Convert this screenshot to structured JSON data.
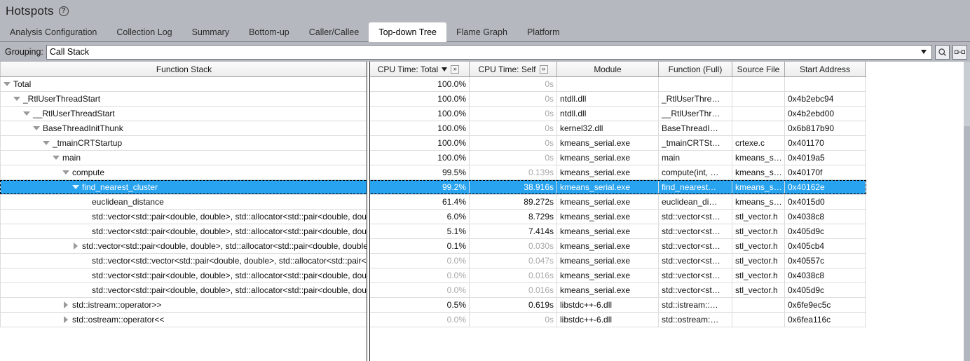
{
  "window": {
    "title": "Hotspots",
    "help_icon": "question-circle-icon"
  },
  "tabs": [
    {
      "label": "Analysis Configuration",
      "active": false
    },
    {
      "label": "Collection Log",
      "active": false
    },
    {
      "label": "Summary",
      "active": false
    },
    {
      "label": "Bottom-up",
      "active": false
    },
    {
      "label": "Caller/Callee",
      "active": false
    },
    {
      "label": "Top-down Tree",
      "active": true
    },
    {
      "label": "Flame Graph",
      "active": false
    },
    {
      "label": "Platform",
      "active": false
    }
  ],
  "toolbar": {
    "grouping_label": "Grouping:",
    "grouping_value": "Call Stack",
    "search_icon": "magnifier-icon",
    "swap_icon": "data-transfer-icon",
    "dropdown_icon": "chevron-down-icon"
  },
  "table": {
    "columns": [
      {
        "label": "Function Stack",
        "sorted": false,
        "more": false
      },
      {
        "label": "CPU Time: Total",
        "sorted": true,
        "sort_dir": "desc",
        "more": true
      },
      {
        "label": "CPU Time: Self",
        "sorted": false,
        "more": true
      },
      {
        "label": "Module",
        "sorted": false,
        "more": false
      },
      {
        "label": "Function (Full)",
        "sorted": false,
        "more": false
      },
      {
        "label": "Source File",
        "sorted": false,
        "more": false
      },
      {
        "label": "Start Address",
        "sorted": false,
        "more": false
      }
    ],
    "rows": [
      {
        "depth": 0,
        "twisty": "down",
        "name": "Total",
        "total": "100.0%",
        "self": "0s",
        "module": "",
        "function": "",
        "source": "",
        "address": "",
        "selected": false,
        "total_dim": false,
        "self_dim": true
      },
      {
        "depth": 1,
        "twisty": "down",
        "name": "_RtlUserThreadStart",
        "total": "100.0%",
        "self": "0s",
        "module": "ntdll.dll",
        "function": "_RtlUserThre…",
        "source": "",
        "address": "0x4b2ebc94",
        "selected": false,
        "total_dim": false,
        "self_dim": true
      },
      {
        "depth": 2,
        "twisty": "down",
        "name": "__RtlUserThreadStart",
        "total": "100.0%",
        "self": "0s",
        "module": "ntdll.dll",
        "function": "__RtlUserThr…",
        "source": "",
        "address": "0x4b2ebd00",
        "selected": false,
        "total_dim": false,
        "self_dim": true
      },
      {
        "depth": 3,
        "twisty": "down",
        "name": "BaseThreadInitThunk",
        "total": "100.0%",
        "self": "0s",
        "module": "kernel32.dll",
        "function": "BaseThreadI…",
        "source": "",
        "address": "0x6b817b90",
        "selected": false,
        "total_dim": false,
        "self_dim": true
      },
      {
        "depth": 4,
        "twisty": "down",
        "name": "_tmainCRTStartup",
        "total": "100.0%",
        "self": "0s",
        "module": "kmeans_serial.exe",
        "function": "_tmainCRTSt…",
        "source": "crtexe.c",
        "address": "0x401170",
        "selected": false,
        "total_dim": false,
        "self_dim": true
      },
      {
        "depth": 5,
        "twisty": "down",
        "name": "main",
        "total": "100.0%",
        "self": "0s",
        "module": "kmeans_serial.exe",
        "function": "main",
        "source": "kmeans_s…",
        "address": "0x4019a5",
        "selected": false,
        "total_dim": false,
        "self_dim": true
      },
      {
        "depth": 6,
        "twisty": "down",
        "name": "compute",
        "total": "99.5%",
        "self": "0.139s",
        "module": "kmeans_serial.exe",
        "function": "compute(int, …",
        "source": "kmeans_s…",
        "address": "0x40170f",
        "selected": false,
        "total_dim": false,
        "self_dim": true
      },
      {
        "depth": 7,
        "twisty": "down",
        "name": "find_nearest_cluster",
        "total": "99.2%",
        "self": "38.916s",
        "module": "kmeans_serial.exe",
        "function": "find_nearest…",
        "source": "kmeans_s…",
        "address": "0x40162e",
        "selected": true,
        "total_dim": false,
        "self_dim": false
      },
      {
        "depth": 8,
        "twisty": "none",
        "name": "euclidean_distance",
        "total": "61.4%",
        "self": "89.272s",
        "module": "kmeans_serial.exe",
        "function": "euclidean_di…",
        "source": "kmeans_s…",
        "address": "0x4015d0",
        "selected": false,
        "total_dim": false,
        "self_dim": false
      },
      {
        "depth": 8,
        "twisty": "none",
        "name": "std::vector<std::pair<double, double>, std::allocator<std::pair<double, double>>>::operator[]",
        "total": "6.0%",
        "self": "8.729s",
        "module": "kmeans_serial.exe",
        "function": "std::vector<st…",
        "source": "stl_vector.h",
        "address": "0x4038c8",
        "selected": false,
        "total_dim": false,
        "self_dim": false
      },
      {
        "depth": 8,
        "twisty": "none",
        "name": "std::vector<std::pair<double, double>, std::allocator<std::pair<double, double>>>::size",
        "total": "5.1%",
        "self": "7.414s",
        "module": "kmeans_serial.exe",
        "function": "std::vector<st…",
        "source": "stl_vector.h",
        "address": "0x405d9c",
        "selected": false,
        "total_dim": false,
        "self_dim": false
      },
      {
        "depth": 7,
        "twisty": "right",
        "name": "std::vector<std::pair<double, double>, std::allocator<std::pair<double, double>>>::begin",
        "total": "0.1%",
        "self": "0.030s",
        "module": "kmeans_serial.exe",
        "function": "std::vector<st…",
        "source": "stl_vector.h",
        "address": "0x405cb4",
        "selected": false,
        "total_dim": false,
        "self_dim": true
      },
      {
        "depth": 8,
        "twisty": "none",
        "name": "std::vector<std::vector<std::pair<double, double>, std::allocator<std::pair<double, double>>>>::operator[]",
        "total": "0.0%",
        "self": "0.047s",
        "module": "kmeans_serial.exe",
        "function": "std::vector<st…",
        "source": "stl_vector.h",
        "address": "0x40557c",
        "selected": false,
        "total_dim": true,
        "self_dim": true
      },
      {
        "depth": 8,
        "twisty": "none",
        "name": "std::vector<std::pair<double, double>, std::allocator<std::pair<double, double>>>::operator[]",
        "total": "0.0%",
        "self": "0.016s",
        "module": "kmeans_serial.exe",
        "function": "std::vector<st…",
        "source": "stl_vector.h",
        "address": "0x4038c8",
        "selected": false,
        "total_dim": true,
        "self_dim": true
      },
      {
        "depth": 8,
        "twisty": "none",
        "name": "std::vector<std::pair<double, double>, std::allocator<std::pair<double, double>>>::size",
        "total": "0.0%",
        "self": "0.016s",
        "module": "kmeans_serial.exe",
        "function": "std::vector<st…",
        "source": "stl_vector.h",
        "address": "0x405d9c",
        "selected": false,
        "total_dim": true,
        "self_dim": true
      },
      {
        "depth": 6,
        "twisty": "right",
        "name": "std::istream::operator>>",
        "total": "0.5%",
        "self": "0.619s",
        "module": "libstdc++-6.dll",
        "function": "std::istream::…",
        "source": "",
        "address": "0x6fe9ec5c",
        "selected": false,
        "total_dim": false,
        "self_dim": false
      },
      {
        "depth": 6,
        "twisty": "right",
        "name": "std::ostream::operator<<",
        "total": "0.0%",
        "self": "0s",
        "module": "libstdc++-6.dll",
        "function": "std::ostream:…",
        "source": "",
        "address": "0x6fea116c",
        "selected": false,
        "total_dim": true,
        "self_dim": true
      }
    ]
  },
  "colors": {
    "selection": "#27a3f0",
    "chrome": "#b5b9bf",
    "header": "#f2f2f2",
    "dim_text": "#a8a8a8"
  }
}
